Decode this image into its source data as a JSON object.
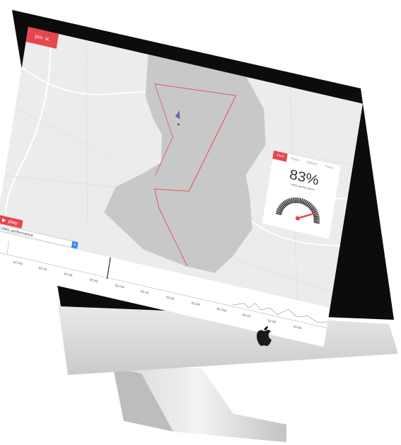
{
  "app": {
    "top_button_label": "pro",
    "play_label": "play",
    "metric_select": "VMG performance"
  },
  "panel": {
    "tabs": [
      "Perf",
      "Race",
      "Speed",
      "Track"
    ],
    "active_tab": 0,
    "percent": "83%",
    "gauge_label": "VMG performance",
    "gauge_value": 0.83
  },
  "timeline": {
    "ticks": [
      "02 PM",
      "02:15",
      "02:30",
      "02:45",
      "03 PM",
      "03:15",
      "03:30",
      "03:45",
      "04 PM",
      "04:15",
      "04:30",
      "04:45"
    ]
  },
  "colors": {
    "accent": "#e8464e",
    "select_button": "#3a8ee6",
    "route": "#e8464e",
    "water": "#c8c8c8",
    "land": "#ececec"
  },
  "icons": {
    "top": "fullscreen-icon",
    "play": "play-icon",
    "brand": "apple-logo"
  }
}
